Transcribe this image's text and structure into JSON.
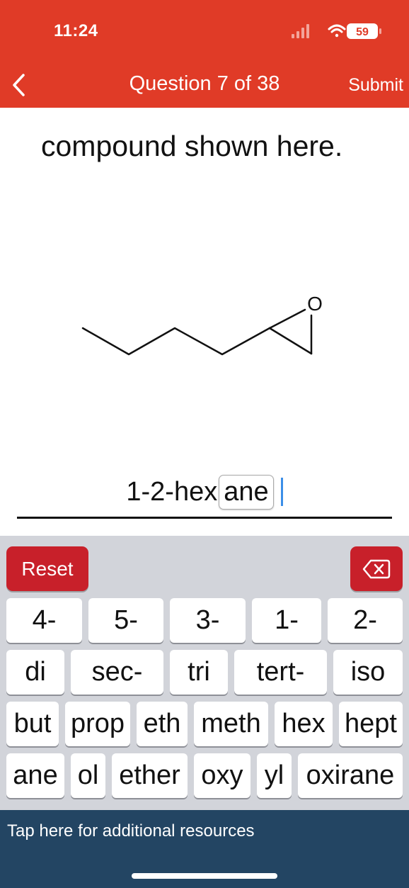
{
  "status_bar": {
    "time": "11:24",
    "battery": "59"
  },
  "header": {
    "title": "Question 7 of 38",
    "submit_label": "Submit"
  },
  "question": {
    "text": "compound shown here.",
    "molecule_atom_label": "O"
  },
  "answer": {
    "prefix": "1-2-hex",
    "token": "ane"
  },
  "keyboard": {
    "reset_label": "Reset",
    "rows": [
      [
        "4-",
        "5-",
        "3-",
        "1-",
        "2-"
      ],
      [
        "di",
        "sec-",
        "tri",
        "tert-",
        "iso"
      ],
      [
        "but",
        "prop",
        "eth",
        "meth",
        "hex",
        "hept"
      ],
      [
        "ane",
        "ol",
        "ether",
        "oxy",
        "yl",
        "oxirane"
      ]
    ]
  },
  "footer": {
    "resources_label": "Tap here for additional resources"
  },
  "colors": {
    "header_bg": "#e03b27",
    "action_red": "#c8202a",
    "keyboard_bg": "#d2d4da",
    "footer_bg": "#234563",
    "cursor_blue": "#3b8ee8"
  }
}
